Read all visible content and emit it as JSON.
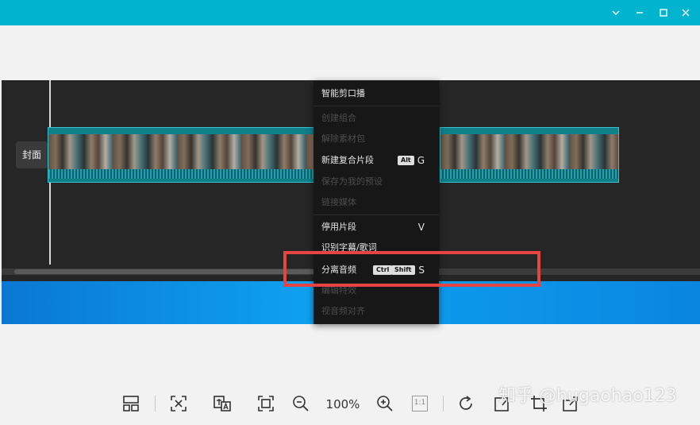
{
  "window": {
    "controls": [
      "chevron-down-icon",
      "minimize-icon",
      "maximize-icon",
      "close-icon"
    ],
    "accent_color": "#00b4cf"
  },
  "timeline": {
    "cover_label": "封面"
  },
  "context_menu": {
    "items": [
      {
        "label": "智能剪口播",
        "enabled": true
      },
      {
        "label": "创建组合",
        "enabled": false
      },
      {
        "label": "解除素材包",
        "enabled": false
      },
      {
        "label": "新建复合片段",
        "enabled": true,
        "keys": [
          "Alt"
        ],
        "hotkey": "G"
      },
      {
        "label": "保存为我的预设",
        "enabled": false
      },
      {
        "label": "链接媒体",
        "enabled": false
      },
      {
        "label": "停用片段",
        "enabled": true,
        "hotkey": "V"
      },
      {
        "label": "识别字幕/歌词",
        "enabled": true
      },
      {
        "label": "分离音频",
        "enabled": true,
        "keys": [
          "Ctrl",
          "Shift"
        ],
        "hotkey": "S"
      },
      {
        "label": "编辑特效",
        "enabled": false
      },
      {
        "label": "视音频对齐",
        "enabled": false
      }
    ],
    "highlight_color": "#e64343"
  },
  "toolbar": {
    "zoom_level": "100%",
    "ratio_label": "1:1",
    "icons": [
      "layout-icon",
      "fit-screen-icon",
      "translate-icon",
      "crop-frame-icon",
      "zoom-out-icon",
      "zoom-in-icon",
      "actual-size-icon",
      "rotate-icon",
      "edit-image-icon",
      "crop-icon",
      "export-icon"
    ]
  },
  "watermark": "知乎 @hugaohao123"
}
